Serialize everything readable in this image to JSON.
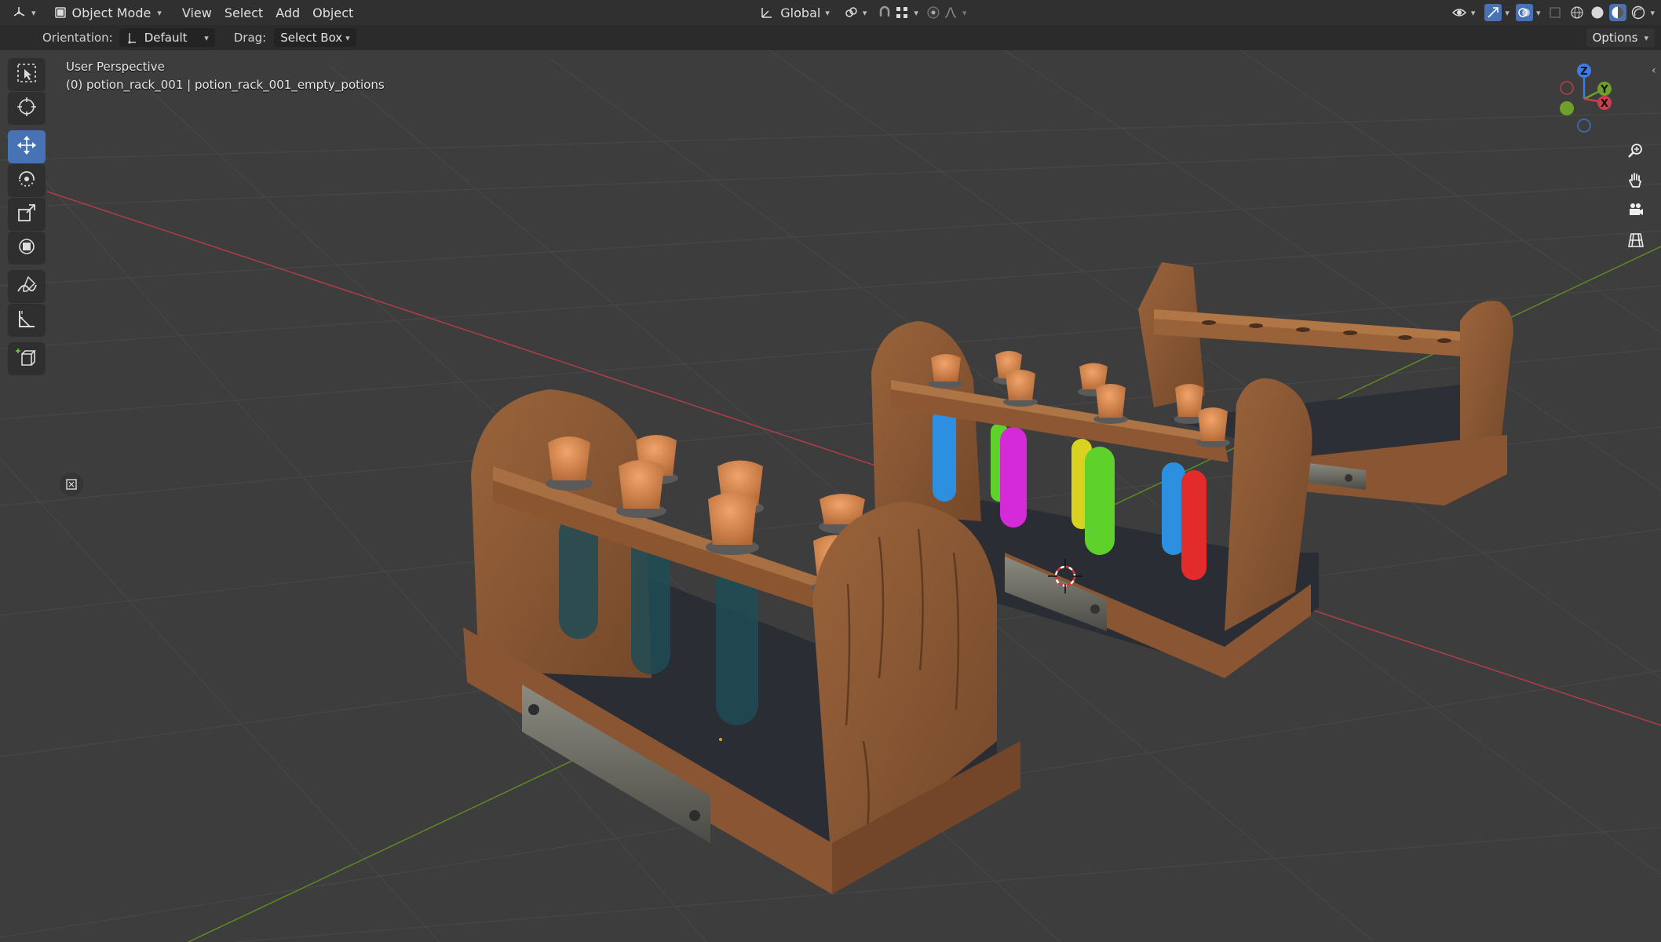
{
  "header": {
    "editor_type_icon": "3d-viewport-icon",
    "mode": "Object Mode",
    "menus": [
      "View",
      "Select",
      "Add",
      "Object"
    ],
    "transform_orientation": "Global",
    "pivot_icon": "pivot-icon",
    "snap_icon": "snap-icon",
    "proportional_icon": "proportional-edit-icon",
    "right_icons": [
      "visibility-icon",
      "gizmo-icon",
      "overlay-icon",
      "xray-icon",
      "wireframe-shading-icon",
      "solid-shading-icon",
      "material-shading-icon",
      "rendered-shading-icon"
    ]
  },
  "toolsettings": {
    "orientation_label": "Orientation:",
    "orientation_value": "Default",
    "drag_label": "Drag:",
    "drag_value": "Select Box",
    "options_label": "Options"
  },
  "viewport": {
    "perspective": "User Perspective",
    "object_info": "(0) potion_rack_001 | potion_rack_001_empty_potions"
  },
  "toolbar": {
    "tools": [
      {
        "name": "select-box",
        "icon": "select-box-icon",
        "active": false
      },
      {
        "name": "cursor",
        "icon": "cursor-icon",
        "active": false
      },
      {
        "name": "move",
        "icon": "move-icon",
        "active": true
      },
      {
        "name": "rotate",
        "icon": "rotate-icon",
        "active": false
      },
      {
        "name": "scale",
        "icon": "scale-icon",
        "active": false
      },
      {
        "name": "transform",
        "icon": "transform-icon",
        "active": false
      },
      {
        "name": "annotate",
        "icon": "annotate-icon",
        "active": false
      },
      {
        "name": "measure",
        "icon": "measure-icon",
        "active": false
      },
      {
        "name": "add-cube",
        "icon": "add-cube-icon",
        "active": false
      }
    ]
  },
  "gizmo": {
    "x": "X",
    "y": "Y",
    "z": "Z"
  },
  "nav_buttons": [
    "zoom-icon",
    "pan-hand-icon",
    "camera-icon",
    "ortho-grid-icon"
  ],
  "colors": {
    "header_bg": "#303030",
    "viewport_bg": "#3d3d3d",
    "active_tool": "#4772b3",
    "x_axis": "#c8404c",
    "y_axis": "#6fa02a",
    "z_axis": "#3e7de0",
    "wood": "#8b5a36",
    "cork": "#d08a52",
    "potion_blue": "#2d8fe0",
    "potion_green": "#5ed12b",
    "potion_magenta": "#d42ad8",
    "potion_yellow": "#d9d21f",
    "potion_red": "#e22b2b"
  }
}
